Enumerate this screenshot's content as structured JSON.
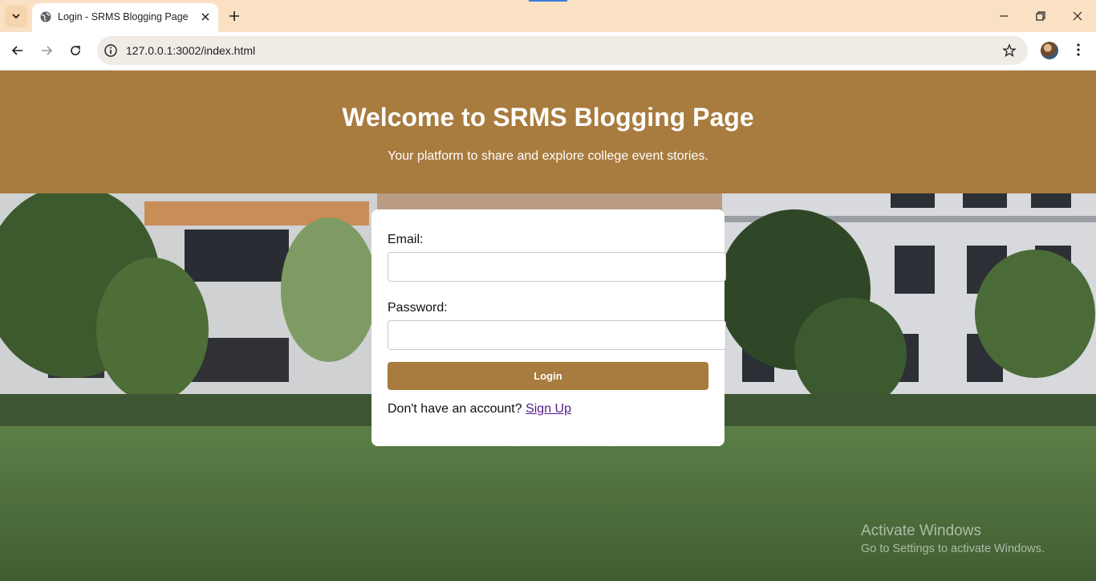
{
  "browser": {
    "tab_title": "Login - SRMS Blogging Page",
    "url": "127.0.0.1:3002/index.html"
  },
  "page": {
    "title": "Welcome to SRMS Blogging Page",
    "subtitle": "Your platform to share and explore college event stories.",
    "accent_color": "#a87b3e"
  },
  "login": {
    "email_label": "Email:",
    "email_value": "",
    "password_label": "Password:",
    "password_value": "",
    "login_button": "Login",
    "signup_prompt": "Don't have an account?",
    "signup_link": "Sign Up"
  },
  "watermark": {
    "title": "Activate Windows",
    "subtitle": "Go to Settings to activate Windows."
  },
  "icons": {
    "tab_search": "chevron-down-icon",
    "favicon": "globe-icon",
    "tab_close": "close-icon",
    "new_tab": "plus-icon",
    "back": "arrow-left-icon",
    "forward": "arrow-right-icon",
    "reload": "reload-icon",
    "site_info": "info-icon",
    "bookmark": "star-icon",
    "menu": "kebab-menu-icon",
    "minimize": "minimize-icon",
    "maximize": "restore-icon",
    "close_window": "close-icon"
  }
}
